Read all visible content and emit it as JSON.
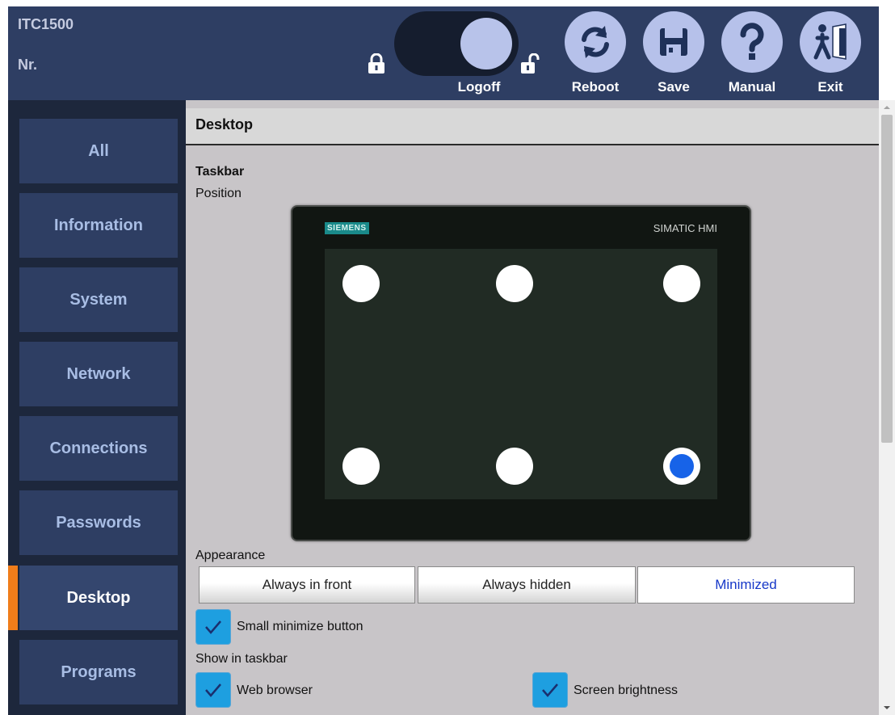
{
  "header": {
    "device_name": "ITC1500",
    "device_nr": "Nr.",
    "logoff_label": "Logoff",
    "buttons": {
      "reboot": "Reboot",
      "save": "Save",
      "manual": "Manual",
      "exit": "Exit"
    }
  },
  "sidebar": {
    "items": [
      {
        "label": "All"
      },
      {
        "label": "Information"
      },
      {
        "label": "System"
      },
      {
        "label": "Network"
      },
      {
        "label": "Connections"
      },
      {
        "label": "Passwords"
      },
      {
        "label": "Desktop",
        "active": true
      },
      {
        "label": "Programs"
      }
    ]
  },
  "content": {
    "title": "Desktop",
    "section_title": "Taskbar",
    "position_label": "Position",
    "device_preview": {
      "brand": "SIEMENS",
      "model": "SIMATIC HMI",
      "selected_position": "bottom-right"
    },
    "appearance": {
      "label": "Appearance",
      "options": [
        "Always in front",
        "Always hidden",
        "Minimized"
      ],
      "selected": "Minimized"
    },
    "small_minimize": {
      "label": "Small minimize button",
      "checked": true
    },
    "show_in_taskbar": {
      "label": "Show in taskbar",
      "web_browser": {
        "label": "Web browser",
        "checked": true
      },
      "screen_brightness": {
        "label": "Screen brightness",
        "checked": true
      }
    }
  },
  "colors": {
    "header_bg": "#2e3e63",
    "sidebar_bg": "#1d273c",
    "active_accent": "#f07d1a",
    "checkbox": "#1e9fe0",
    "radio_selected": "#1763e8"
  }
}
